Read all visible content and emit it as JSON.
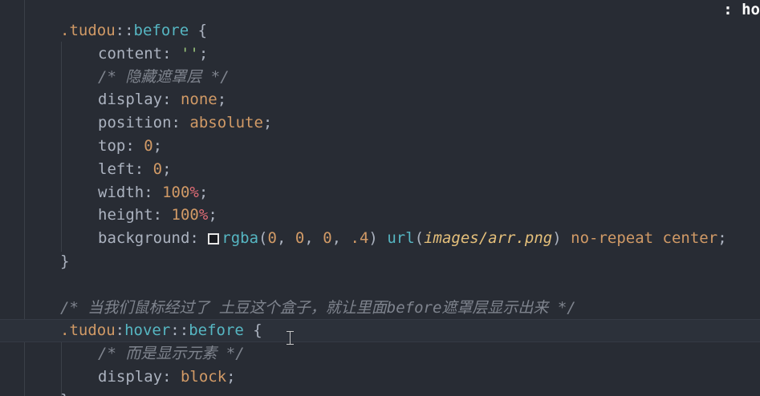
{
  "corner_text": ": ho",
  "colors": {
    "background": "#282c34",
    "selector": "#d19a66",
    "pseudo": "#56b6c2",
    "string": "#98c379",
    "number": "#d19a66",
    "unit": "#e06c75",
    "comment": "#7f848e",
    "path": "#e5c07b"
  },
  "lines": [
    {
      "tokens": [
        {
          "t": ".tudou",
          "c": "sel"
        },
        {
          "t": "::",
          "c": "pu"
        },
        {
          "t": "before",
          "c": "ps"
        },
        {
          "t": " {",
          "c": "pu"
        }
      ]
    },
    {
      "tokens": [
        {
          "t": "content",
          "c": "pr"
        },
        {
          "t": ": ",
          "c": "pu"
        },
        {
          "t": "''",
          "c": "str"
        },
        {
          "t": ";",
          "c": "pu"
        }
      ]
    },
    {
      "tokens": [
        {
          "t": "/* 隐藏遮罩层 */",
          "c": "cmt"
        }
      ]
    },
    {
      "tokens": [
        {
          "t": "display",
          "c": "pr"
        },
        {
          "t": ": ",
          "c": "pu"
        },
        {
          "t": "none",
          "c": "kw"
        },
        {
          "t": ";",
          "c": "pu"
        }
      ]
    },
    {
      "tokens": [
        {
          "t": "position",
          "c": "pr"
        },
        {
          "t": ": ",
          "c": "pu"
        },
        {
          "t": "absolute",
          "c": "kw"
        },
        {
          "t": ";",
          "c": "pu"
        }
      ]
    },
    {
      "tokens": [
        {
          "t": "top",
          "c": "pr"
        },
        {
          "t": ": ",
          "c": "pu"
        },
        {
          "t": "0",
          "c": "num"
        },
        {
          "t": ";",
          "c": "pu"
        }
      ]
    },
    {
      "tokens": [
        {
          "t": "left",
          "c": "pr"
        },
        {
          "t": ": ",
          "c": "pu"
        },
        {
          "t": "0",
          "c": "num"
        },
        {
          "t": ";",
          "c": "pu"
        }
      ]
    },
    {
      "tokens": [
        {
          "t": "width",
          "c": "pr"
        },
        {
          "t": ": ",
          "c": "pu"
        },
        {
          "t": "100",
          "c": "num"
        },
        {
          "t": "%",
          "c": "unit"
        },
        {
          "t": ";",
          "c": "pu"
        }
      ]
    },
    {
      "tokens": [
        {
          "t": "height",
          "c": "pr"
        },
        {
          "t": ": ",
          "c": "pu"
        },
        {
          "t": "100",
          "c": "num"
        },
        {
          "t": "%",
          "c": "unit"
        },
        {
          "t": ";",
          "c": "pu"
        }
      ]
    },
    {
      "tokens": [
        {
          "t": "background",
          "c": "pr"
        },
        {
          "t": ": ",
          "c": "pu"
        },
        {
          "t": "",
          "c": "swatch"
        },
        {
          "t": "rgba",
          "c": "fn"
        },
        {
          "t": "(",
          "c": "pu"
        },
        {
          "t": "0",
          "c": "num"
        },
        {
          "t": ", ",
          "c": "pu"
        },
        {
          "t": "0",
          "c": "num"
        },
        {
          "t": ", ",
          "c": "pu"
        },
        {
          "t": "0",
          "c": "num"
        },
        {
          "t": ", ",
          "c": "pu"
        },
        {
          "t": ".4",
          "c": "num"
        },
        {
          "t": ") ",
          "c": "pu"
        },
        {
          "t": "url",
          "c": "fn"
        },
        {
          "t": "(",
          "c": "pu"
        },
        {
          "t": "images/arr.png",
          "c": "path"
        },
        {
          "t": ") ",
          "c": "pu"
        },
        {
          "t": "no-repeat",
          "c": "kw"
        },
        {
          "t": " ",
          "c": "pu"
        },
        {
          "t": "center",
          "c": "kw"
        },
        {
          "t": ";",
          "c": "pu"
        }
      ]
    },
    {
      "tokens": [
        {
          "t": "}",
          "c": "pu"
        }
      ]
    },
    {
      "tokens": []
    },
    {
      "tokens": [
        {
          "t": "/* 当我们鼠标经过了 土豆这个盒子，就让里面before遮罩层显示出来 */",
          "c": "cmt"
        }
      ]
    },
    {
      "tokens": [
        {
          "t": ".tudou",
          "c": "sel"
        },
        {
          "t": ":",
          "c": "pu"
        },
        {
          "t": "hover",
          "c": "ps"
        },
        {
          "t": "::",
          "c": "pu"
        },
        {
          "t": "before",
          "c": "ps"
        },
        {
          "t": " {",
          "c": "pu"
        }
      ]
    },
    {
      "tokens": [
        {
          "t": "/* 而是显示元素 */",
          "c": "cmt"
        }
      ]
    },
    {
      "tokens": [
        {
          "t": "display",
          "c": "pr"
        },
        {
          "t": ": ",
          "c": "pu"
        },
        {
          "t": "block",
          "c": "kw"
        },
        {
          "t": ";",
          "c": "pu"
        }
      ]
    },
    {
      "tokens": [
        {
          "t": "}",
          "c": "pu"
        }
      ]
    }
  ]
}
